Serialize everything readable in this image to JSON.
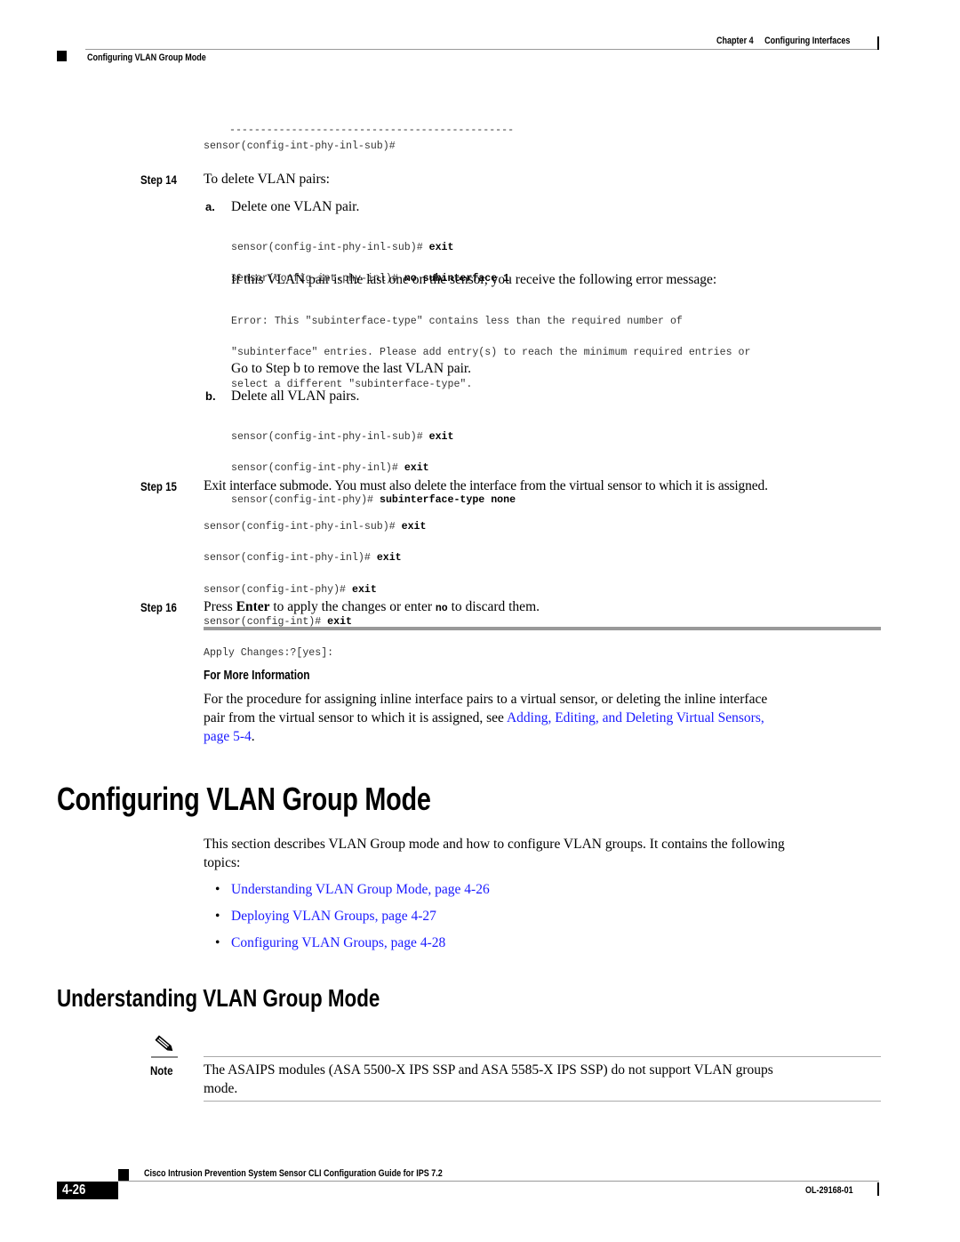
{
  "header": {
    "chapter": "Chapter 4",
    "chapter_title": "Configuring Interfaces",
    "section": "Configuring VLAN Group Mode"
  },
  "top_code": {
    "dashes": "----------------------------------------------",
    "prompt": "sensor(config-int-phy-inl-sub)#"
  },
  "step14": {
    "label": "Step 14",
    "text": "To delete VLAN pairs:",
    "sub_a": {
      "label": "a.",
      "text": "Delete one VLAN pair.",
      "code": [
        {
          "prompt": "sensor(config-int-phy-inl-sub)# ",
          "cmd": "exit"
        },
        {
          "prompt": "sensor(config-int-phy-inl)# ",
          "cmd": "no subinterface 1"
        }
      ],
      "note": "If this VLAN pair is the last one on the sensor, you receive the following error message:",
      "error_lines": [
        "Error: This \"subinterface-type\" contains less than the required number of",
        "\"subinterface\" entries. Please add entry(s) to reach the minimum required entries or",
        "select a different \"subinterface-type\"."
      ],
      "followup": "Go to Step b to remove the last VLAN pair."
    },
    "sub_b": {
      "label": "b.",
      "text": "Delete all VLAN pairs.",
      "code": [
        {
          "prompt": "sensor(config-int-phy-inl-sub)# ",
          "cmd": "exit"
        },
        {
          "prompt": "sensor(config-int-phy-inl)# ",
          "cmd": "exit"
        },
        {
          "prompt": "sensor(config-int-phy)# ",
          "cmd": "subinterface-type none"
        }
      ]
    }
  },
  "step15": {
    "label": "Step 15",
    "text": "Exit interface submode. You must also delete the interface from the virtual sensor to which it is assigned.",
    "code": [
      {
        "prompt": "sensor(config-int-phy-inl-sub)# ",
        "cmd": "exit"
      },
      {
        "prompt": "sensor(config-int-phy-inl)# ",
        "cmd": "exit"
      },
      {
        "prompt": "sensor(config-int-phy)# ",
        "cmd": "exit"
      },
      {
        "prompt": "sensor(config-int)# ",
        "cmd": "exit"
      },
      {
        "prompt": "Apply Changes:?[yes]:",
        "cmd": ""
      }
    ]
  },
  "step16": {
    "label": "Step 16",
    "text_pre": "Press ",
    "text_bold": "Enter",
    "text_mid": " to apply the changes or enter ",
    "text_code": "no",
    "text_post": " to discard them."
  },
  "more_info": {
    "heading": "For More Information",
    "text_line1": "For the procedure for assigning inline interface pairs to a virtual sensor, or deleting the inline interface",
    "text_line2_pre": "pair from the virtual sensor to which it is assigned, see ",
    "link_part1": "Adding, Editing, and Deleting Virtual Sensors,",
    "link_part2": "page 5-4",
    "text_post": "."
  },
  "section_main": {
    "title": "Configuring VLAN Group Mode",
    "intro_line1": "This section describes VLAN Group mode and how to configure VLAN groups. It contains the following",
    "intro_line2": "topics:",
    "bullet": "•",
    "topics": [
      "Understanding VLAN Group Mode, page 4-26",
      "Deploying VLAN Groups, page 4-27",
      "Configuring VLAN Groups, page 4-28"
    ]
  },
  "section_sub": {
    "title": "Understanding VLAN Group Mode",
    "note_icon": "pencil-note-icon",
    "note_label": "Note",
    "note_line1": "The ASAIPS modules (ASA 5500-X IPS SSP and ASA 5585-X IPS SSP) do not support VLAN groups",
    "note_line2": "mode."
  },
  "footer": {
    "guide_title": "Cisco Intrusion Prevention System Sensor CLI Configuration Guide for IPS 7.2",
    "page_number": "4-26",
    "doc_id": "OL-29168-01"
  }
}
